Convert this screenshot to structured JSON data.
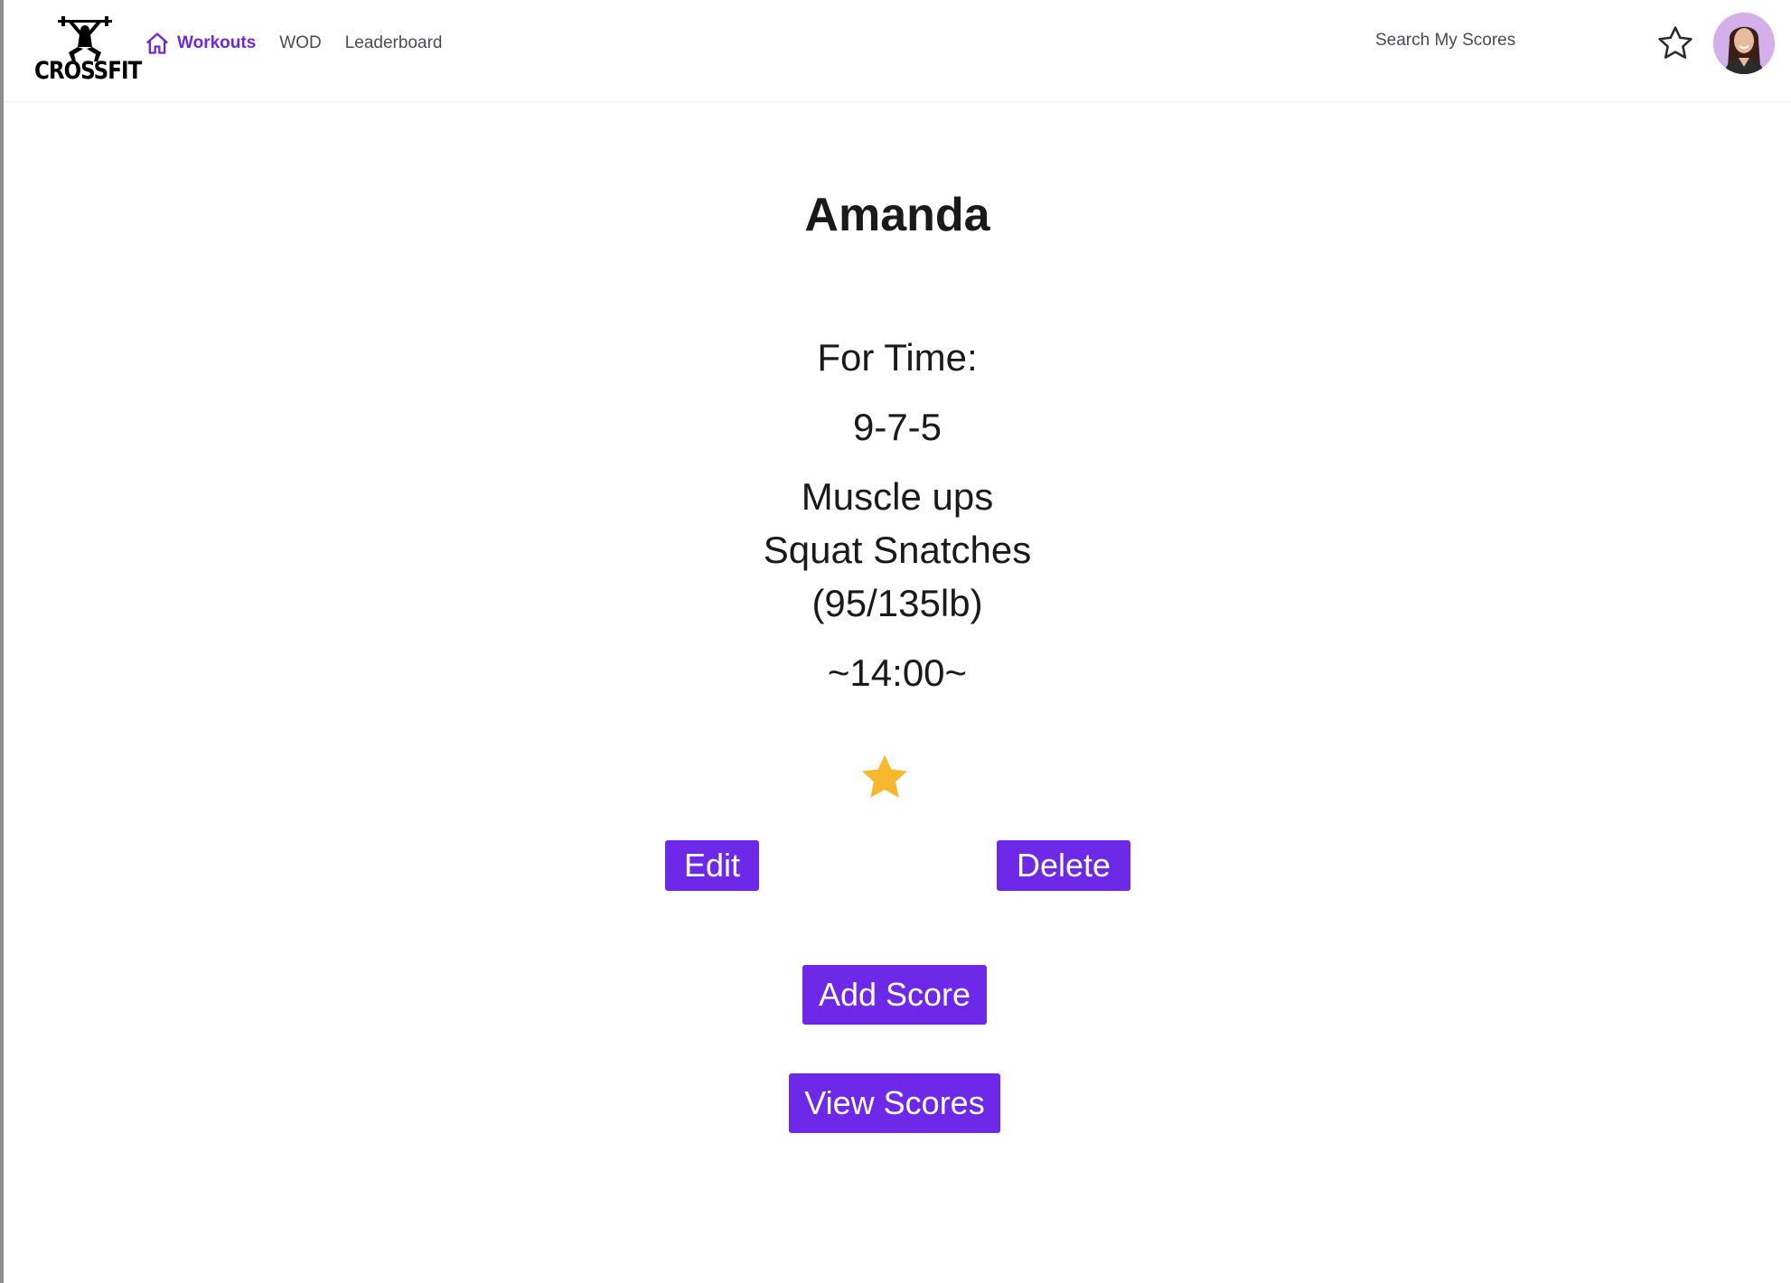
{
  "app": {
    "logo_text": "CROSSFIT"
  },
  "nav": {
    "items": [
      {
        "label": "Workouts",
        "icon": "home-icon",
        "active": true
      },
      {
        "label": "WOD",
        "active": false
      },
      {
        "label": "Leaderboard",
        "active": false
      }
    ]
  },
  "header": {
    "search_placeholder": "Search My Scores",
    "favorites_icon": "star-outline-icon",
    "avatar_icon": "user-avatar"
  },
  "workout": {
    "name": "Amanda",
    "format": "For Time:",
    "reps": "9-7-5",
    "movements": [
      "Muscle ups",
      "Squat Snatches",
      "(95/135lb)"
    ],
    "time": "~14:00~",
    "favorited": true
  },
  "actions": {
    "edit_label": "Edit",
    "delete_label": "Delete",
    "add_score_label": "Add Score",
    "view_scores_label": "View Scores"
  },
  "colors": {
    "accent": "#6d28e8",
    "active_nav": "#6d28d9",
    "star": "#f5b82e",
    "text": "#1a1a1a"
  }
}
